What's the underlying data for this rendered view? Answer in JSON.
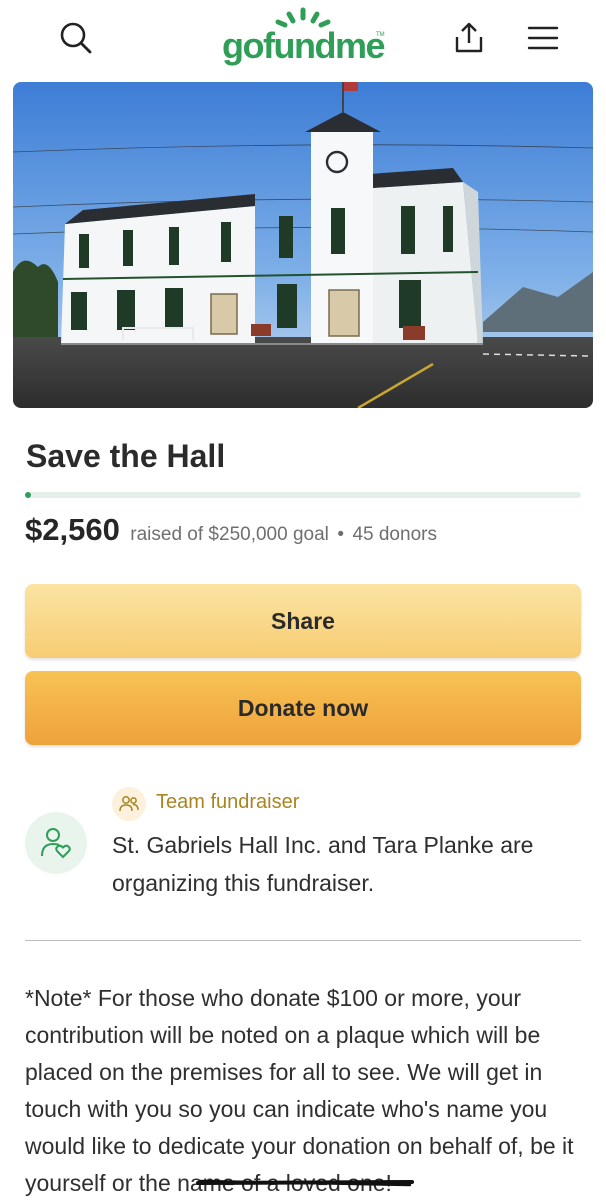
{
  "header": {
    "logo_text": "gofundme",
    "logo_tm": "TM",
    "brand_color": "#2f9e56",
    "icons": [
      "search-icon",
      "share-upload-icon",
      "hamburger-menu-icon"
    ]
  },
  "campaign": {
    "title": "Save the Hall",
    "progress_fraction": 0.01,
    "raised": "$2,560",
    "goal_text": "raised of $250,000 goal",
    "separator": "•",
    "donors_text": "45 donors"
  },
  "buttons": {
    "share_label": "Share",
    "donate_label": "Donate now"
  },
  "organizer": {
    "team_label": "Team fundraiser",
    "description": "St. Gabriels Hall Inc. and Tara Planke are organizing this fundraiser."
  },
  "story": {
    "text": "*Note* For those who donate $100 or more, your contribution will be noted on a plaque which will be placed on the premises for all to see. We will get in touch with you so you can indicate who's name you would like to dedicate your donation on behalf of, be it yourself or the name of a loved one!"
  },
  "colors": {
    "accent_green": "#2e9e5a",
    "share_button": "#f9d88a",
    "donate_button": "#f3b146",
    "team_gold": "#a98521"
  }
}
